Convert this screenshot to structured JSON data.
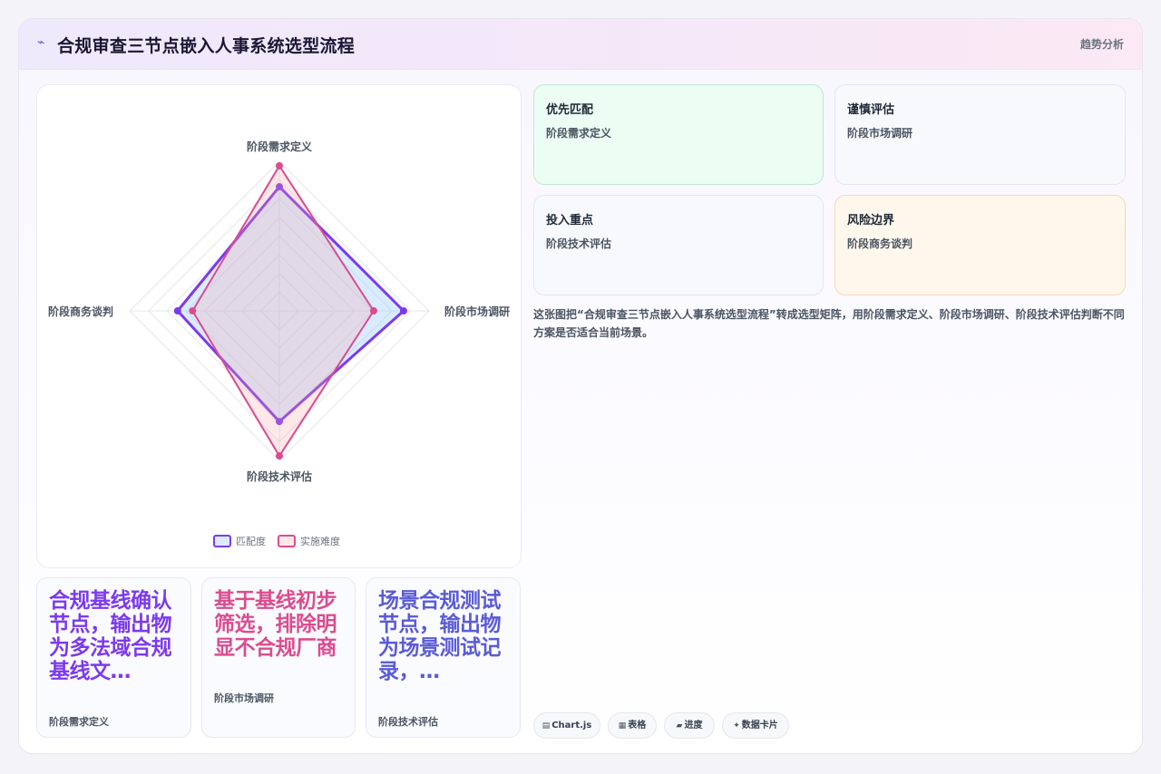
{
  "header": {
    "icon": "trend-icon",
    "title": "合规审查三节点嵌入人事系统选型流程",
    "right_link": "趋势分析"
  },
  "chart_data": {
    "type": "radar",
    "axes": [
      "阶段需求定义",
      "阶段市场调研",
      "阶段技术评估",
      "阶段商务谈判"
    ],
    "rmax": 100,
    "series": [
      {
        "name": "匹配度",
        "values": [
          83,
          83,
          74,
          68
        ],
        "color": "#7c3aed",
        "fill": "rgba(147,197,253,0.35)"
      },
      {
        "name": "实施难度",
        "values": [
          97,
          63,
          97,
          58
        ],
        "color": "#db4c8f",
        "fill": "rgba(252,165,165,0.25)"
      }
    ]
  },
  "cards": [
    {
      "title": "优先匹配",
      "sub": "阶段需求定义",
      "bg": "#ecfdf3",
      "border": "#bfe9cd"
    },
    {
      "title": "谨慎评估",
      "sub": "阶段市场调研",
      "bg": "#f8f9fc",
      "border": "#e3e6ee"
    },
    {
      "title": "投入重点",
      "sub": "阶段技术评估",
      "bg": "#f8f9fc",
      "border": "#e3e6ee"
    },
    {
      "title": "风险边界",
      "sub": "阶段商务谈判",
      "bg": "#fff7ec",
      "border": "#f6d9b2"
    }
  ],
  "description": "这张图把“合规审查三节点嵌入人事系统选型流程”转成选型矩阵，用阶段需求定义、阶段市场调研、阶段技术评估判断不同方案是否适合当前场景。",
  "tags": [
    {
      "icon": "▤",
      "label": "Chart.js"
    },
    {
      "icon": "▦",
      "label": "表格"
    },
    {
      "icon": "▰",
      "label": "进度"
    },
    {
      "icon": "✦",
      "label": "数据卡片"
    }
  ],
  "stat_cards": [
    {
      "big": "合规基线确认节点，输出物为多法域合规基线文…",
      "small": "阶段需求定义",
      "color": "#7c3aed"
    },
    {
      "big": "基于基线初步筛选，排除明显不合规厂商",
      "small": "阶段市场调研",
      "color": "#db4c8f"
    },
    {
      "big": "场景合规测试节点，输出物为场景测试记录，…",
      "small": "阶段技术评估",
      "color": "#5b5bd6"
    }
  ]
}
